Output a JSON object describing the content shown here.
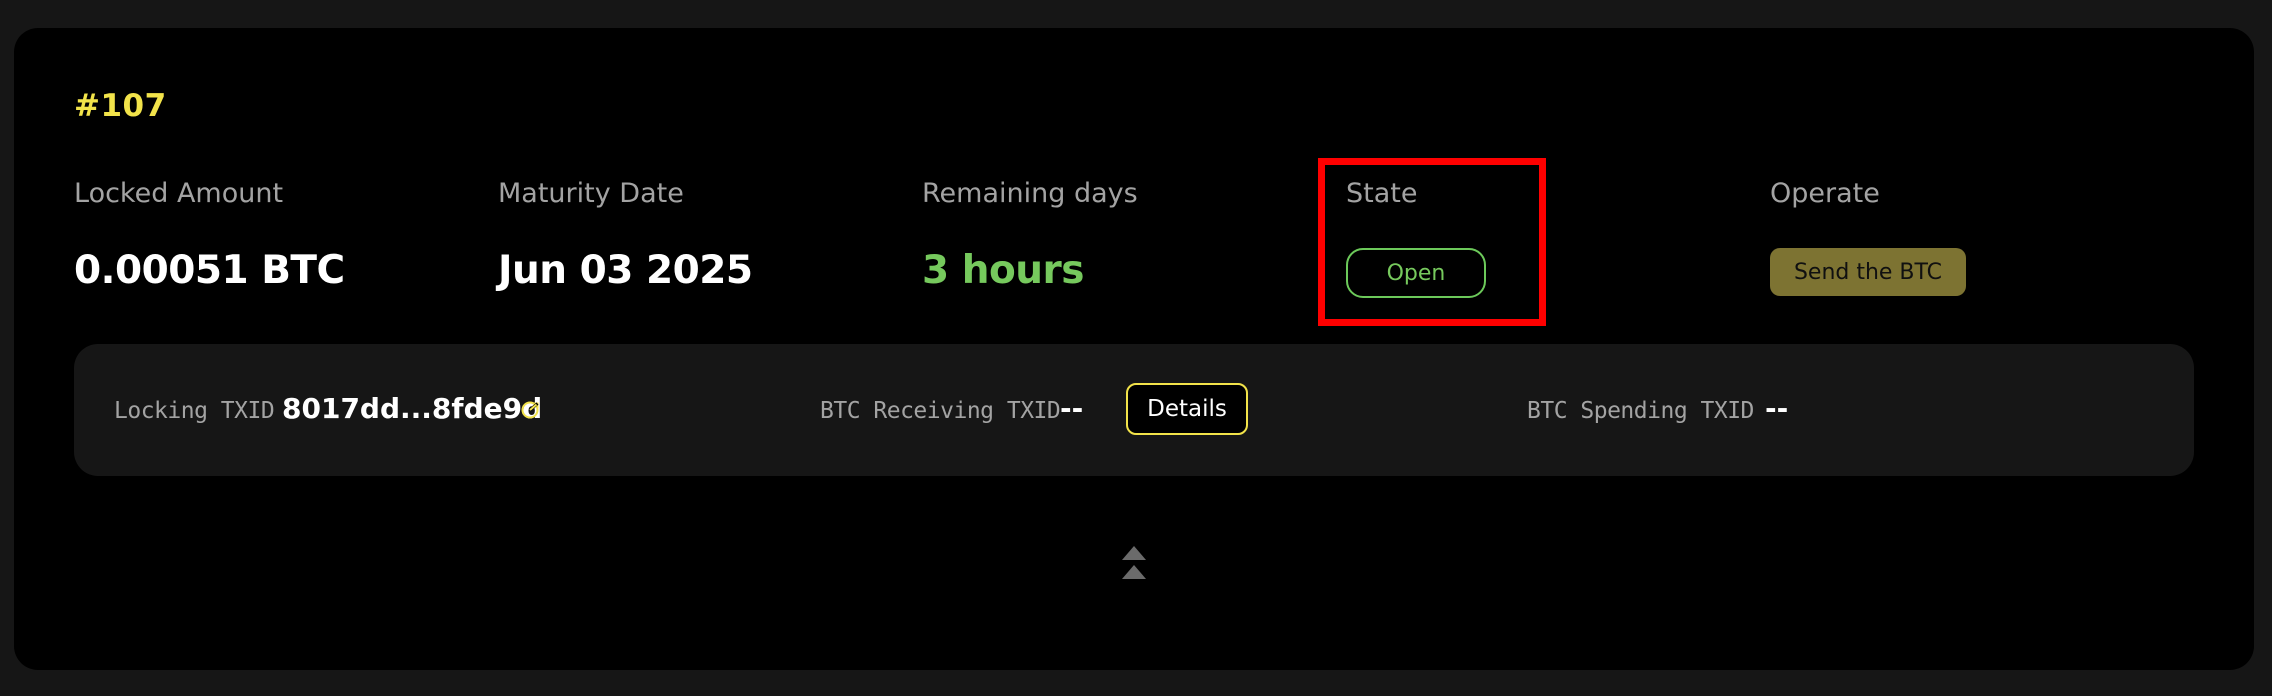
{
  "lock": {
    "id": "#107",
    "locked_amount": {
      "label": "Locked Amount",
      "value": "0.00051 BTC"
    },
    "maturity_date": {
      "label": "Maturity Date",
      "value": "Jun 03 2025"
    },
    "remaining_days": {
      "label": "Remaining days",
      "value": "3 hours"
    },
    "state": {
      "label": "State",
      "value": "Open"
    },
    "operate": {
      "label": "Operate",
      "button_label": "Send the BTC"
    }
  },
  "transactions": {
    "locking_txid": {
      "label": "Locking TXID",
      "value": "8017dd...8fde9d"
    },
    "btc_receiving_txid": {
      "label": "BTC Receiving TXID",
      "value": "--",
      "details_label": "Details"
    },
    "btc_spending_txid": {
      "label": "BTC Spending TXID",
      "value": "--"
    }
  },
  "icons": {
    "copy": "copy-icon",
    "collapse": "collapse-up-icon"
  },
  "colors": {
    "accent_yellow": "#f2e34a",
    "state_green": "#76c95d",
    "highlight_red": "#ff0000",
    "operate_button": "#7d7332"
  }
}
